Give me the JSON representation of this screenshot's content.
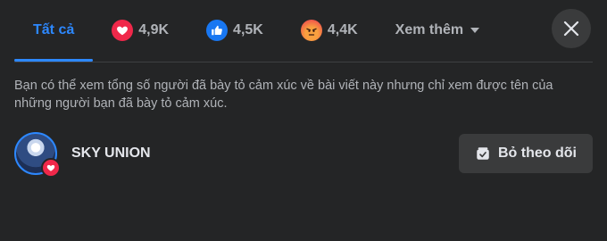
{
  "tabs": {
    "all_label": "Tất cả",
    "love_count": "4,9K",
    "like_count": "4,5K",
    "angry_count": "4,4K",
    "more_label": "Xem thêm"
  },
  "notice": "Bạn có thể xem tổng số người đã bày tỏ cảm xúc về bài viết này nhưng chỉ xem được tên của những người bạn đã bày tỏ cảm xúc.",
  "reactors": [
    {
      "name": "SKY UNION",
      "reaction": "love",
      "action_label": "Bỏ theo dõi"
    }
  ],
  "colors": {
    "accent": "#2d88ff",
    "love": "#f0284a",
    "like": "#1877f2",
    "angry": "#f7714c"
  },
  "icons": {
    "close": "close-icon",
    "love": "heart-icon",
    "like": "thumbs-up-icon",
    "angry": "angry-face-icon",
    "more": "caret-down-icon",
    "unfollow": "unfollow-icon"
  }
}
